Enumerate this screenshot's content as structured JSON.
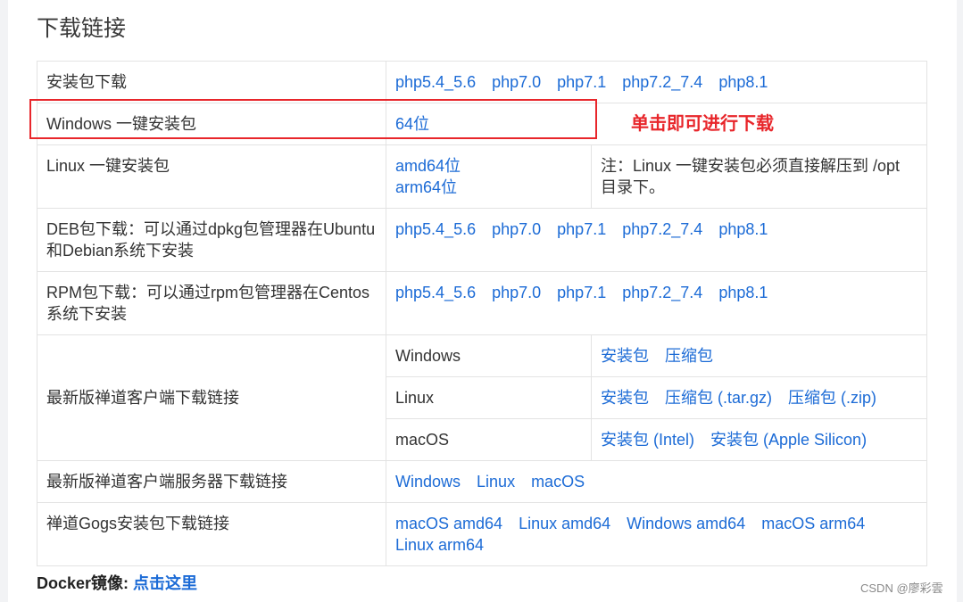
{
  "page_title": "下载链接",
  "php_links": [
    "php5.4_5.6",
    "php7.0",
    "php7.1",
    "php7.2_7.4",
    "php8.1"
  ],
  "rows": {
    "installer": {
      "label": "安装包下载"
    },
    "windows_one_click": {
      "label": "Windows 一键安装包",
      "link": "64位"
    },
    "linux_one_click": {
      "label": "Linux 一键安装包",
      "links": [
        "amd64位",
        "arm64位"
      ],
      "note": "注：Linux 一键安装包必须直接解压到 /opt 目录下。"
    },
    "deb": {
      "label": "DEB包下载：可以通过dpkg包管理器在Ubuntu和Debian系统下安装"
    },
    "rpm": {
      "label": "RPM包下载：可以通过rpm包管理器在Centos系统下安装"
    },
    "client": {
      "label": "最新版禅道客户端下载链接",
      "platforms": [
        {
          "name": "Windows",
          "links": [
            "安装包",
            "压缩包"
          ]
        },
        {
          "name": "Linux",
          "links": [
            "安装包",
            "压缩包 (.tar.gz)",
            "压缩包 (.zip)"
          ]
        },
        {
          "name": "macOS",
          "links": [
            "安装包 (Intel)",
            "安装包 (Apple Silicon)"
          ]
        }
      ]
    },
    "client_server": {
      "label": "最新版禅道客户端服务器下载链接",
      "links": [
        "Windows",
        "Linux",
        "macOS"
      ]
    },
    "gogs": {
      "label": "禅道Gogs安装包下载链接",
      "links": [
        "macOS amd64",
        "Linux amd64",
        "Windows amd64",
        "macOS arm64",
        "Linux arm64"
      ]
    }
  },
  "annotation": "单击即可进行下载",
  "docker": {
    "label": "Docker镜像:",
    "link": "点击这里"
  },
  "watermark": "CSDN @廖彩雲",
  "colors": {
    "link": "#1c6bd6",
    "annotation": "#e8262b",
    "note": "#e02b2b"
  }
}
